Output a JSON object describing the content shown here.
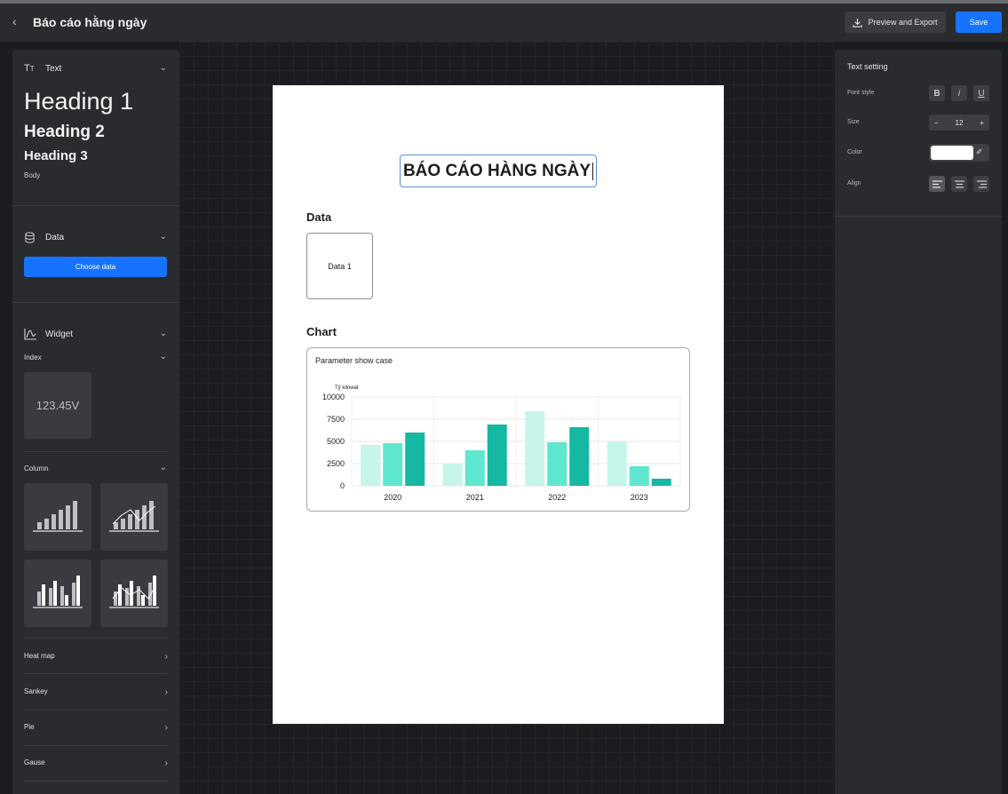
{
  "header": {
    "title": "Báo cáo hằng ngày",
    "export_label": "Preview and Export",
    "save_label": "Save"
  },
  "left_panel": {
    "text_section": {
      "label": "Text",
      "heading1": "Heading 1",
      "heading2": "Heading 2",
      "heading3": "Heading 3",
      "body": "Body"
    },
    "data_section": {
      "label": "Data",
      "choose_button": "Choose data"
    },
    "widget_section": {
      "label": "Widget",
      "index": {
        "label": "Index",
        "sample_value": "123.45V"
      },
      "column": {
        "label": "Column"
      },
      "items": [
        "Heat map",
        "Sankey",
        "Pie",
        "Gause"
      ]
    }
  },
  "right_panel": {
    "title": "Text setting",
    "font_style_label": "Font style",
    "font_buttons": {
      "bold": "B",
      "italic": "i",
      "underline": "U"
    },
    "size_label": "Size",
    "size_value": "12",
    "size_minus": "−",
    "size_plus": "+",
    "color_label": "Color",
    "color_value": "#ffffff",
    "align_label": "Align"
  },
  "document": {
    "title": "BÁO CÁO HÀNG NGÀY",
    "data_heading": "Data",
    "data_card": "Data 1",
    "chart_heading": "Chart",
    "chart_card_title": "Parameter show case"
  },
  "chart_data": {
    "type": "bar",
    "ylabel": "Tỷ kilowat",
    "categories": [
      "2020",
      "2021",
      "2022",
      "2023"
    ],
    "series": [
      {
        "values": [
          4600,
          2500,
          8400,
          5000
        ],
        "color": "#c6f5ea"
      },
      {
        "values": [
          4800,
          4000,
          4900,
          2200
        ],
        "color": "#5ee6cf"
      },
      {
        "values": [
          6000,
          6900,
          6600,
          800
        ],
        "color": "#15b8a2"
      }
    ],
    "ylim": [
      0,
      10000
    ],
    "yticks": [
      0,
      2500,
      5000,
      7500,
      10000
    ],
    "ytick_labels": [
      "0",
      "2500",
      "5000",
      "7500",
      "10000"
    ],
    "grid": true
  }
}
